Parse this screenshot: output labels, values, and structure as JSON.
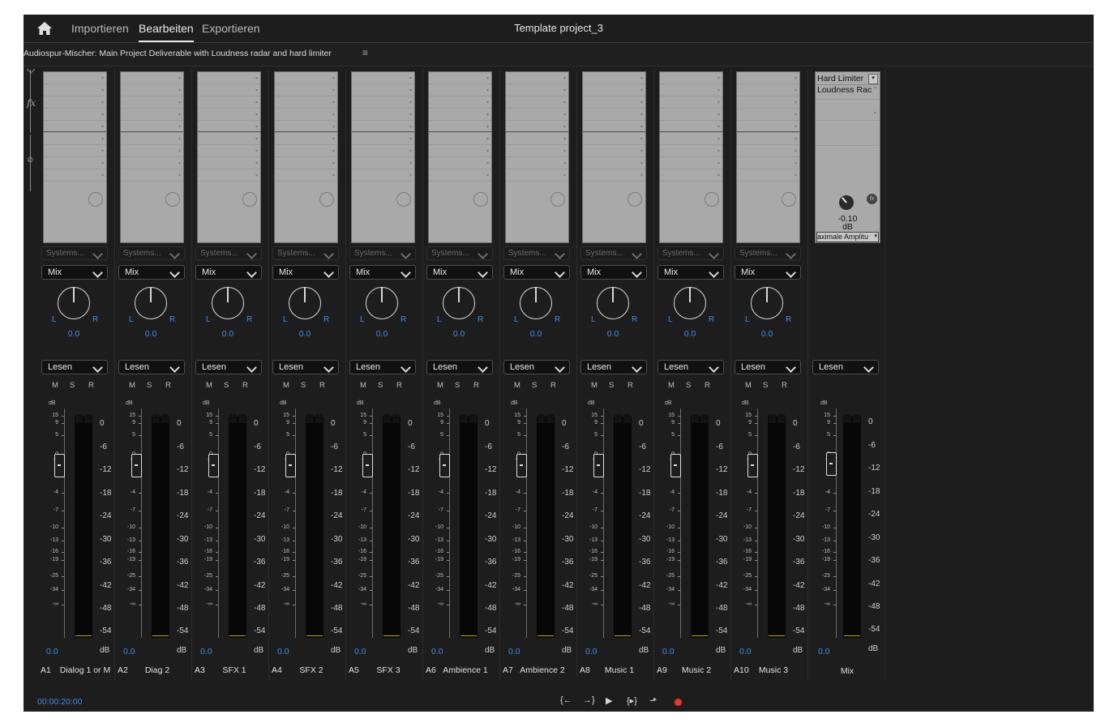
{
  "nav": {
    "home_icon": "home-icon",
    "tabs": [
      "Importieren",
      "Bearbeiten",
      "Exportieren"
    ],
    "active_tab": "Bearbeiten",
    "project_title": "Template project_3"
  },
  "panel": {
    "title": "Audiospur-Mischer: Main Project Deliverable with Loudness radar and hard limiter",
    "menu_icon": "hamburger-menu-icon"
  },
  "rail": {
    "fx_label": "fx",
    "send_icon": "send-icon"
  },
  "channels": [
    {
      "id": "A1",
      "name": "Dialog 1 or M",
      "send": "Systems...",
      "mode": "Mix",
      "pan": "0.0",
      "pan_l": "L",
      "pan_r": "R",
      "automation": "Lesen",
      "volume": "0.0"
    },
    {
      "id": "A2",
      "name": "Diag 2",
      "send": "Systems...",
      "mode": "Mix",
      "pan": "0.0",
      "pan_l": "L",
      "pan_r": "R",
      "automation": "Lesen",
      "volume": "0.0"
    },
    {
      "id": "A3",
      "name": "SFX 1",
      "send": "Systems...",
      "mode": "Mix",
      "pan": "0.0",
      "pan_l": "L",
      "pan_r": "R",
      "automation": "Lesen",
      "volume": "0.0"
    },
    {
      "id": "A4",
      "name": "SFX 2",
      "send": "Systems...",
      "mode": "Mix",
      "pan": "0.0",
      "pan_l": "L",
      "pan_r": "R",
      "automation": "Lesen",
      "volume": "0.0"
    },
    {
      "id": "A5",
      "name": "SFX 3",
      "send": "Systems...",
      "mode": "Mix",
      "pan": "0.0",
      "pan_l": "L",
      "pan_r": "R",
      "automation": "Lesen",
      "volume": "0.0"
    },
    {
      "id": "A6",
      "name": "Ambience 1",
      "send": "Systems...",
      "mode": "Mix",
      "pan": "0.0",
      "pan_l": "L",
      "pan_r": "R",
      "automation": "Lesen",
      "volume": "0.0"
    },
    {
      "id": "A7",
      "name": "Ambience 2",
      "send": "Systems...",
      "mode": "Mix",
      "pan": "0.0",
      "pan_l": "L",
      "pan_r": "R",
      "automation": "Lesen",
      "volume": "0.0"
    },
    {
      "id": "A8",
      "name": "Music 1",
      "send": "Systems...",
      "mode": "Mix",
      "pan": "0.0",
      "pan_l": "L",
      "pan_r": "R",
      "automation": "Lesen",
      "volume": "0.0"
    },
    {
      "id": "A9",
      "name": "Music 2",
      "send": "Systems...",
      "mode": "Mix",
      "pan": "0.0",
      "pan_l": "L",
      "pan_r": "R",
      "automation": "Lesen",
      "volume": "0.0"
    },
    {
      "id": "A10",
      "name": "Music 3",
      "send": "Systems...",
      "mode": "Mix",
      "pan": "0.0",
      "pan_l": "L",
      "pan_r": "R",
      "automation": "Lesen",
      "volume": "0.0"
    }
  ],
  "msr": [
    "M",
    "S",
    "R"
  ],
  "fader_scale": {
    "db_label": "dB",
    "left_ticks": [
      "15",
      "9",
      "5",
      "0",
      "-1",
      "-4",
      "-7",
      "-10",
      "-13",
      "-16",
      "-19",
      "-25",
      "-34",
      "-∞"
    ],
    "right_ticks": [
      "0",
      "-6",
      "-12",
      "-18",
      "-24",
      "-30",
      "-36",
      "-42",
      "-48",
      "-54",
      "dB"
    ]
  },
  "master": {
    "effects": [
      "Hard Limiter",
      "Loudness Rac"
    ],
    "param_value": "-0.10",
    "param_unit": "dB",
    "param_name": "aximale Amplitu",
    "automation": "Lesen",
    "volume": "0.0",
    "name": "Mix"
  },
  "transport": {
    "timecode": "00:00:20:00",
    "buttons": [
      "mark-in-icon",
      "mark-out-icon",
      "play-icon",
      "go-to-in-icon",
      "export-frame-icon",
      "record-icon"
    ]
  },
  "colors": {
    "accent_blue": "#3d8ee8",
    "record_red": "#e8362e",
    "peak_yellow": "#c8a800"
  }
}
